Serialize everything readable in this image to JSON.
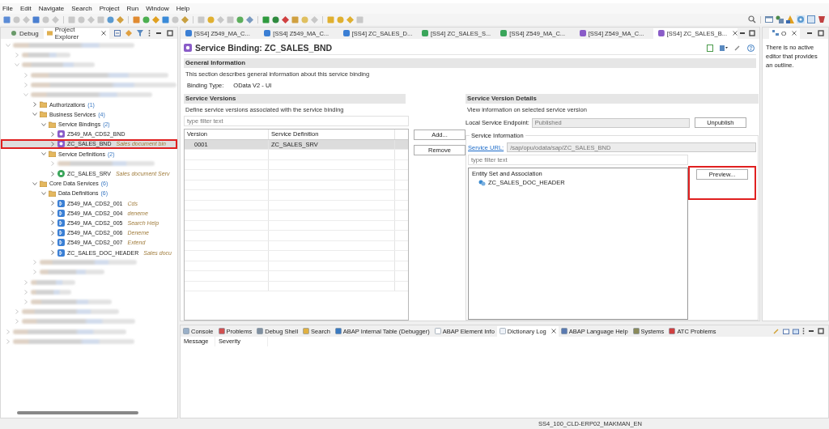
{
  "menu": [
    "File",
    "Edit",
    "Navigate",
    "Search",
    "Project",
    "Run",
    "Window",
    "Help"
  ],
  "left_tabs": [
    {
      "label": "Debug",
      "kind": "debug",
      "selected": false,
      "closable": false
    },
    {
      "label": "Project Explorer",
      "kind": "explorer",
      "selected": true,
      "closable": true
    }
  ],
  "tree": [
    {
      "kind": "blurred",
      "expanded": true,
      "selected": false,
      "children": [
        {
          "kind": "blurred",
          "expanded": false,
          "selected": false
        },
        {
          "kind": "blurred",
          "expanded": true,
          "selected": false,
          "children": [
            {
              "kind": "blurred",
              "expanded": false,
              "selected": false
            },
            {
              "kind": "blurred",
              "expanded": false,
              "selected": false
            },
            {
              "kind": "blurred",
              "expanded": true,
              "selected": false,
              "children": [
                {
                  "kind": "folder",
                  "label": "Authorizations",
                  "count": "(1)",
                  "expanded": false,
                  "selected": false
                },
                {
                  "kind": "folder",
                  "label": "Business Services",
                  "count": "(4)",
                  "expanded": true,
                  "selected": false,
                  "children": [
                    {
                      "kind": "folder",
                      "label": "Service Bindings",
                      "count": "(2)",
                      "expanded": true,
                      "selected": false,
                      "children": [
                        {
                          "kind": "binding",
                          "label": "Z549_MA_CDS2_BND",
                          "expanded": false,
                          "selected": false
                        },
                        {
                          "kind": "binding",
                          "label": "ZC_SALES_BND",
                          "description": "Sales document bin",
                          "expanded": false,
                          "selected": true,
                          "highlighted": true
                        }
                      ]
                    },
                    {
                      "kind": "folder",
                      "label": "Service Definitions",
                      "count": "(2)",
                      "expanded": true,
                      "selected": false,
                      "children": [
                        {
                          "kind": "blurred",
                          "expanded": false,
                          "selected": false
                        },
                        {
                          "kind": "service",
                          "label": "ZC_SALES_SRV",
                          "description": "Sales document Serv",
                          "expanded": false,
                          "selected": false
                        }
                      ]
                    }
                  ]
                },
                {
                  "kind": "folder",
                  "label": "Core Data Services",
                  "count": "(6)",
                  "expanded": true,
                  "selected": false,
                  "children": [
                    {
                      "kind": "folder",
                      "label": "Data Definitions",
                      "count": "(6)",
                      "expanded": true,
                      "selected": false,
                      "children": [
                        {
                          "kind": "ddl",
                          "label": "Z549_MA_CDS2_001",
                          "description": "Cds",
                          "expanded": false,
                          "selected": false
                        },
                        {
                          "kind": "ddl",
                          "label": "Z549_MA_CDS2_004",
                          "description": "deneme",
                          "expanded": false,
                          "selected": false
                        },
                        {
                          "kind": "ddl",
                          "label": "Z549_MA_CDS2_005",
                          "description": "Search Help",
                          "expanded": false,
                          "selected": false
                        },
                        {
                          "kind": "ddl",
                          "label": "Z549_MA_CDS2_006",
                          "description": "Deneme",
                          "expanded": false,
                          "selected": false
                        },
                        {
                          "kind": "ddl",
                          "label": "Z549_MA_CDS2_007",
                          "description": "Extend",
                          "expanded": false,
                          "selected": false
                        },
                        {
                          "kind": "ddl",
                          "label": "ZC_SALES_DOC_HEADER",
                          "description": "Sales docu",
                          "expanded": false,
                          "selected": false
                        }
                      ]
                    }
                  ]
                },
                {
                  "kind": "blurred",
                  "expanded": false,
                  "selected": false
                },
                {
                  "kind": "blurred",
                  "expanded": false,
                  "selected": false
                }
              ]
            },
            {
              "kind": "blurred",
              "expanded": false,
              "selected": false
            },
            {
              "kind": "blurred",
              "expanded": false,
              "selected": false
            },
            {
              "kind": "blurred",
              "expanded": false,
              "selected": false
            }
          ]
        },
        {
          "kind": "blurred",
          "expanded": false,
          "selected": false
        },
        {
          "kind": "blurred",
          "expanded": false,
          "selected": false
        }
      ]
    },
    {
      "kind": "blurred",
      "expanded": false,
      "selected": false
    },
    {
      "kind": "blurred",
      "expanded": false,
      "selected": false
    }
  ],
  "editor_tabs": [
    {
      "label": "[SS4] Z549_MA_C...",
      "kind": "ddl",
      "selected": false
    },
    {
      "label": "[SS4] Z549_MA_C...",
      "kind": "ddl",
      "selected": false
    },
    {
      "label": "[SS4] ZC_SALES_D...",
      "kind": "ddl",
      "selected": false
    },
    {
      "label": "[SS4] ZC_SALES_S...",
      "kind": "service",
      "selected": false
    },
    {
      "label": "[SS4] Z549_MA_C...",
      "kind": "service",
      "selected": false
    },
    {
      "label": "[SS4] Z549_MA_C...",
      "kind": "binding",
      "selected": false
    },
    {
      "label": "[SS4] ZC_SALES_B...",
      "kind": "binding",
      "selected": true
    }
  ],
  "editor": {
    "title": "Service Binding: ZC_SALES_BND",
    "general": {
      "heading": "General Information",
      "description": "This section describes general information about this service binding",
      "binding_type_label": "Binding Type:",
      "binding_type": "OData V2 - UI"
    },
    "versions": {
      "heading": "Service Versions",
      "description": "Define service versions associated with the service binding",
      "filter": {
        "placeholder": "type filter text"
      },
      "columns": [
        "Version",
        "Service Definition"
      ],
      "rows": [
        {
          "cells": [
            "0001",
            "ZC_SALES_SRV"
          ],
          "selected": true
        }
      ],
      "buttons": [
        "Add...",
        "Remove"
      ]
    },
    "details": {
      "heading": "Service Version Details",
      "description": "View information on selected service version",
      "endpoint_label": "Local Service Endpoint:",
      "endpoint": "Published",
      "unpublish": "Unpublish",
      "group_title": "Service Information",
      "url_label": "Service URL:",
      "url": "/sap/opu/odata/sap/ZC_SALES_BND",
      "filter": {
        "placeholder": "type filter text"
      },
      "entity_heading": "Entity Set and Association",
      "entities": [
        "ZC_SALES_DOC_HEADER"
      ],
      "preview": {
        "label": "Preview...",
        "highlighted": true
      }
    }
  },
  "outline": {
    "tab": "O",
    "message": "There is no active editor that provides an outline."
  },
  "bottom_tabs": [
    {
      "label": "Console",
      "selected": false
    },
    {
      "label": "Problems",
      "selected": false
    },
    {
      "label": "Debug Shell",
      "selected": false
    },
    {
      "label": "Search",
      "selected": false
    },
    {
      "label": "ABAP Internal Table (Debugger)",
      "selected": false
    },
    {
      "label": "ABAP Element Info",
      "selected": false
    },
    {
      "label": "Dictionary Log",
      "selected": true
    },
    {
      "label": "ABAP Language Help",
      "selected": false
    },
    {
      "label": "Systems",
      "selected": false
    },
    {
      "label": "ATC Problems",
      "selected": false
    }
  ],
  "log_columns": [
    "Message",
    "Severity"
  ],
  "status_bar": "SS4_100_CLD-ERP02_MAKMAN_EN"
}
